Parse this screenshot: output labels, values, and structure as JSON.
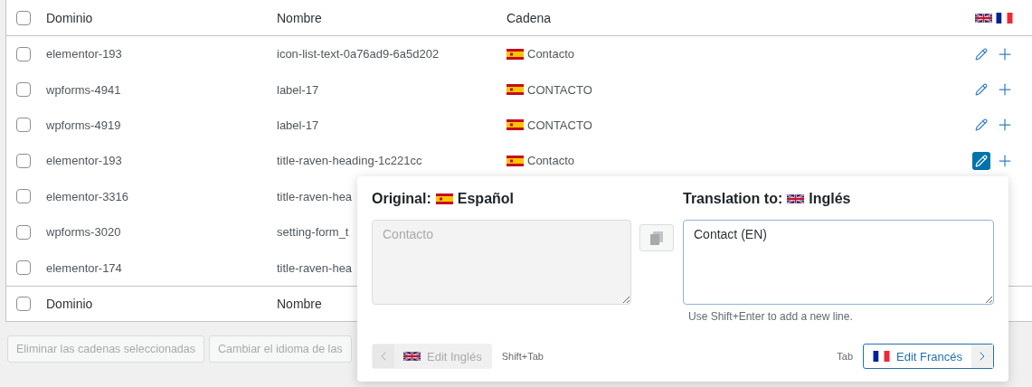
{
  "table": {
    "select_all_checked": false,
    "columns": [
      "Dominio",
      "Nombre",
      "Cadena"
    ],
    "rows": [
      {
        "checked": false,
        "domain": "elementor-193",
        "name": "icon-list-text-0a76ad9-6a5d202",
        "string": "Contacto",
        "active": false
      },
      {
        "checked": false,
        "domain": "wpforms-4941",
        "name": "label-17",
        "string": "CONTACTO",
        "active": false
      },
      {
        "checked": false,
        "domain": "wpforms-4919",
        "name": "label-17",
        "string": "CONTACTO",
        "active": false
      },
      {
        "checked": false,
        "domain": "elementor-193",
        "name": "title-raven-heading-1c221cc",
        "string": "Contacto",
        "active": true
      },
      {
        "checked": false,
        "domain": "elementor-3316",
        "name": "title-raven-hea"
      },
      {
        "checked": false,
        "domain": "wpforms-3020",
        "name": "setting-form_t"
      },
      {
        "checked": false,
        "domain": "elementor-174",
        "name": "title-raven-hea"
      }
    ],
    "footer": {
      "checked": false,
      "columns": [
        "Dominio",
        "Nombre"
      ]
    }
  },
  "bulk_buttons": [
    "Eliminar las cadenas seleccionadas",
    "Cambiar el idioma de las"
  ],
  "popup": {
    "original_label": "Original:",
    "original_language": "Español",
    "translation_label": "Translation to:",
    "translation_language": "Inglés",
    "original_text": "Contacto",
    "translation_text": "Contact (EN)",
    "hint": "Use Shift+Enter to add a new line.",
    "prev": {
      "label": "Edit Inglés",
      "disabled": true,
      "shortcut": "Shift+Tab"
    },
    "next": {
      "label": "Edit Francés",
      "disabled": false,
      "shortcut": "Tab"
    }
  }
}
